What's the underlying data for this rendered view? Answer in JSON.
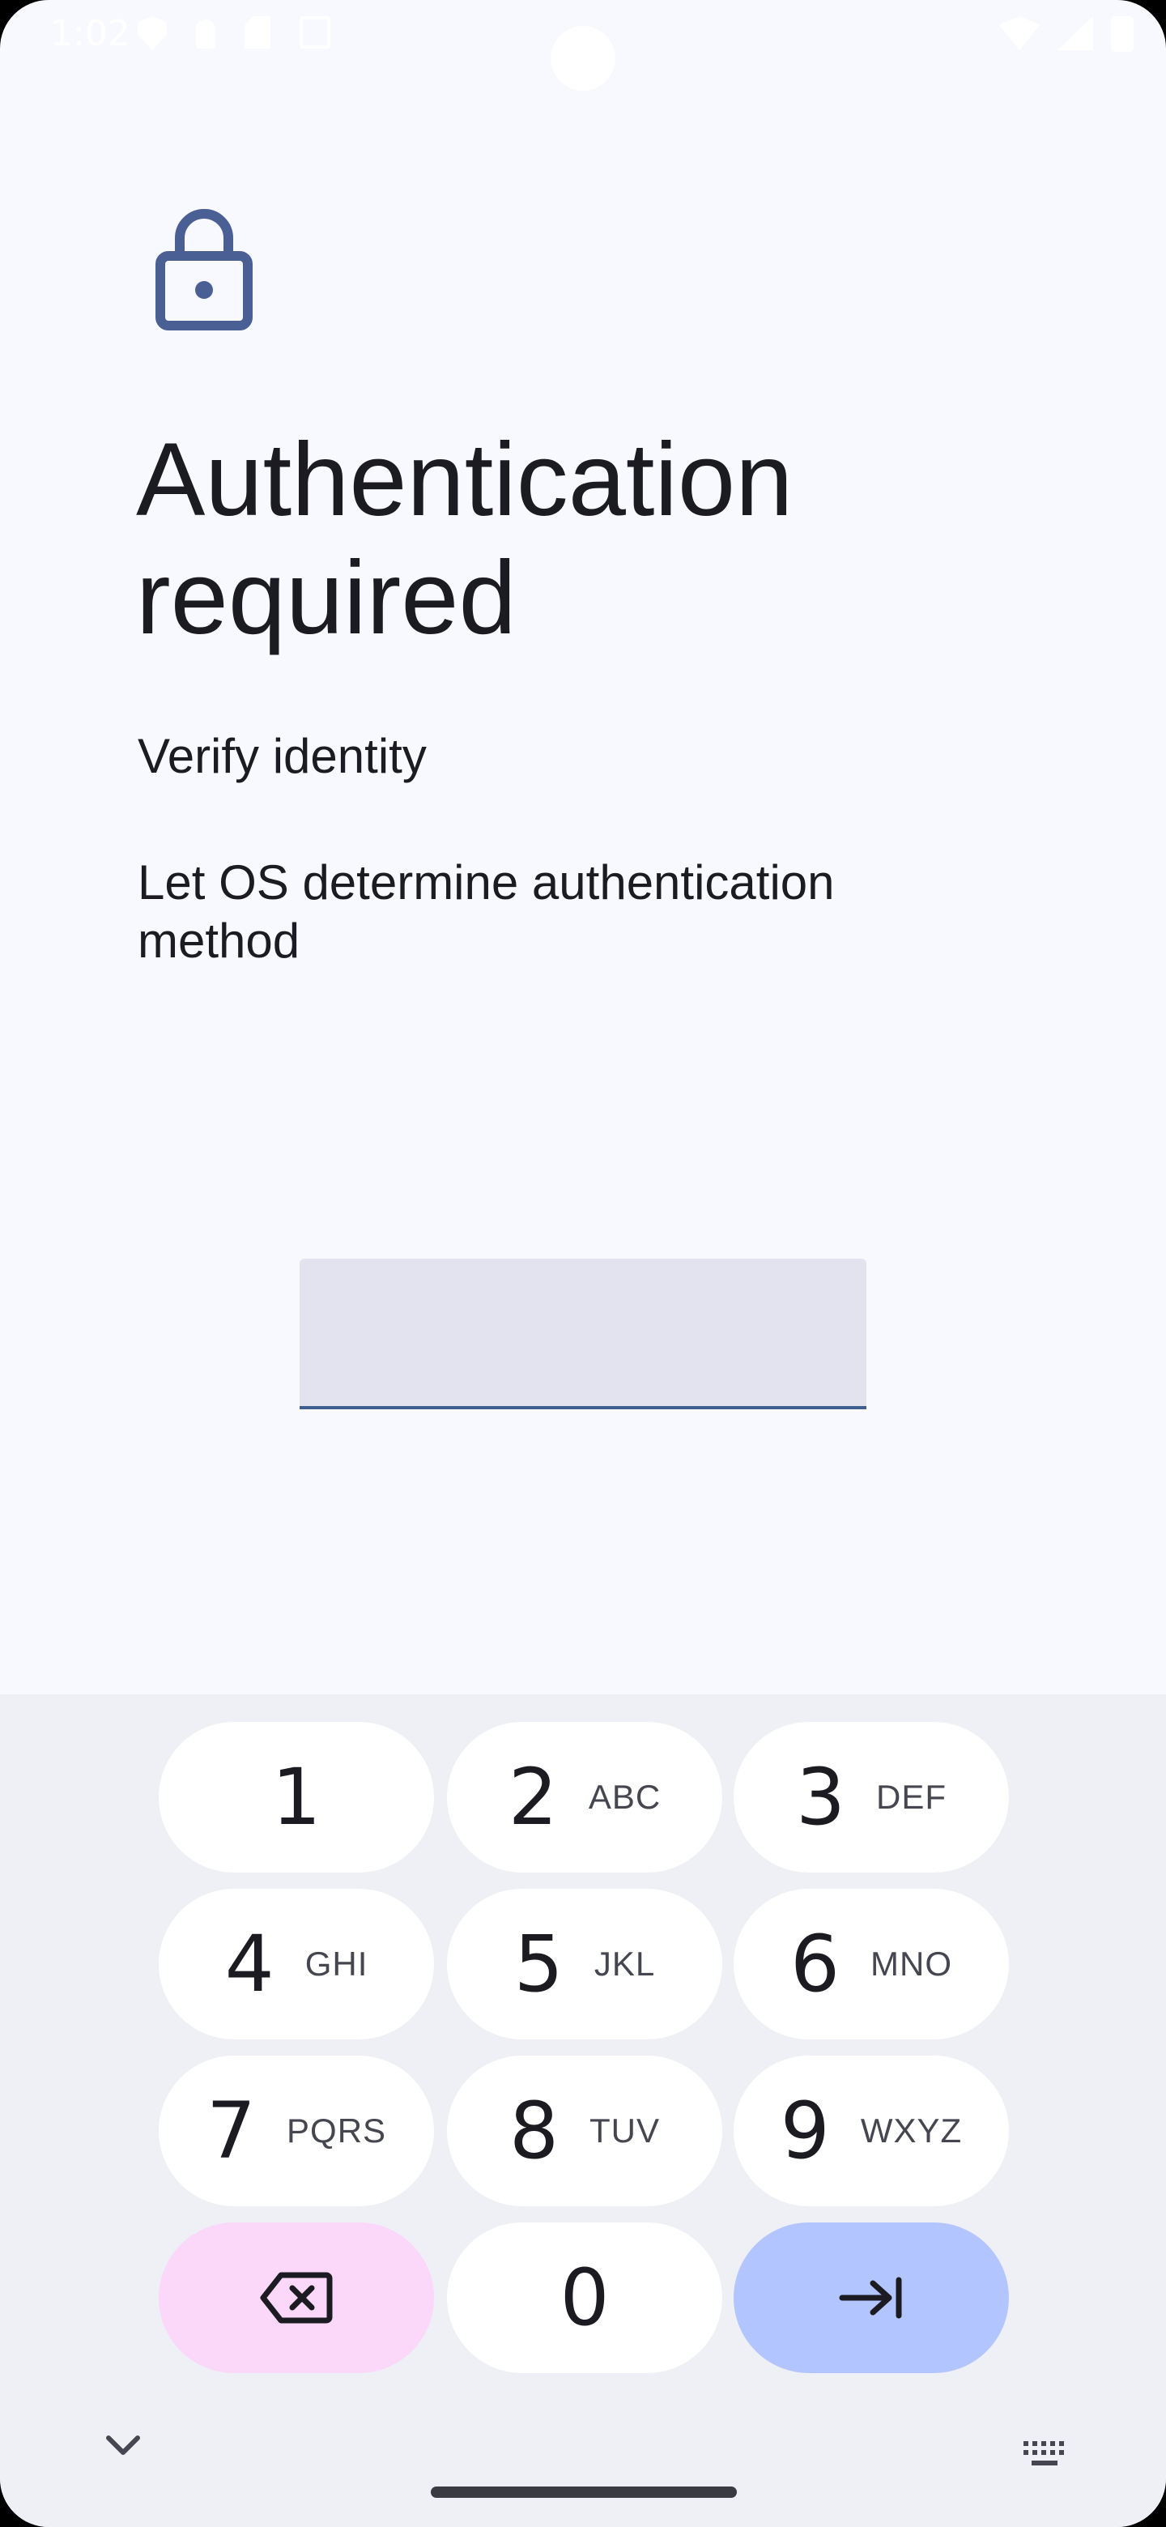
{
  "status_bar": {
    "time": "1:02",
    "left_icons": [
      "shield-icon",
      "person-icon",
      "sd-card-icon",
      "font-icon"
    ],
    "right_icons": [
      "wifi-icon",
      "signal-icon",
      "battery-icon"
    ]
  },
  "auth": {
    "icon": "lock-icon",
    "title": "Authentication required",
    "subtitle": "Verify identity",
    "description": "Let OS determine authentication method",
    "pin_value": ""
  },
  "keyboard": {
    "keys": [
      {
        "digit": "1",
        "letters": ""
      },
      {
        "digit": "2",
        "letters": "ABC"
      },
      {
        "digit": "3",
        "letters": "DEF"
      },
      {
        "digit": "4",
        "letters": "GHI"
      },
      {
        "digit": "5",
        "letters": "JKL"
      },
      {
        "digit": "6",
        "letters": "MNO"
      },
      {
        "digit": "7",
        "letters": "PQRS"
      },
      {
        "digit": "8",
        "letters": "TUV"
      },
      {
        "digit": "9",
        "letters": "WXYZ"
      },
      {
        "digit": "0",
        "letters": ""
      }
    ],
    "delete_icon": "backspace-icon",
    "next_icon": "tab-arrow-icon",
    "collapse_icon": "chevron-down-icon",
    "switch_icon": "keyboard-icon"
  },
  "colors": {
    "accent": "#4a5f94",
    "background": "#f8f8ff",
    "keyboard_bg": "#efeff6",
    "delete_key": "#fbd7f9",
    "next_key": "#b2c5ff"
  }
}
